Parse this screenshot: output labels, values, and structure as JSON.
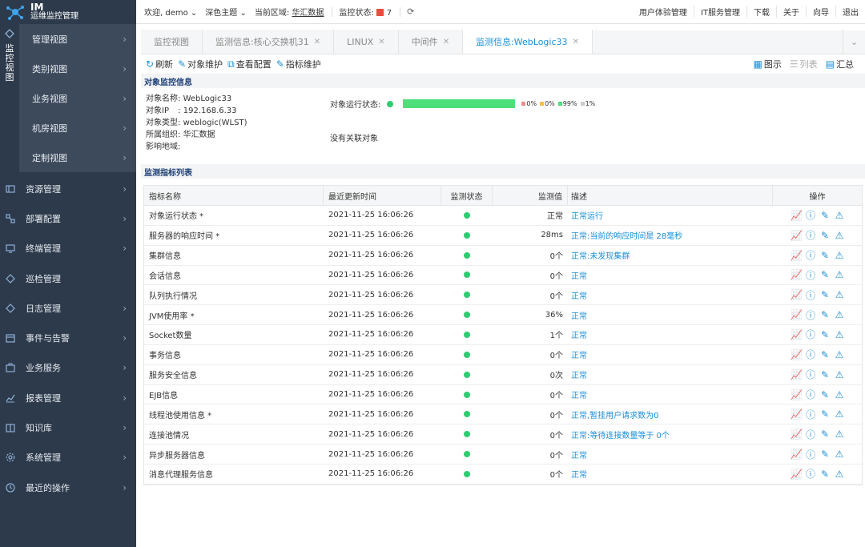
{
  "app": {
    "logo_title": "IM",
    "logo_subtitle": "运维监控管理"
  },
  "topbar": {
    "welcome_label": "欢迎,",
    "user": "demo",
    "theme": "深色主题",
    "region_label": "当前区域:",
    "region_value": "华汇数据",
    "monitor_status_label": "监控状态:",
    "monitor_status_count": "7",
    "right_links": [
      "用户体验管理",
      "IT服务管理",
      "下载",
      "关于",
      "向导",
      "退出"
    ]
  },
  "sidebar": {
    "monitor_view_label": "监控视图",
    "sub_items": [
      "管理视图",
      "类别视图",
      "业务视图",
      "机房视图",
      "定制视图"
    ],
    "items": [
      {
        "label": "资源管理",
        "icon": "resource-icon"
      },
      {
        "label": "部署配置",
        "icon": "deploy-icon"
      },
      {
        "label": "终端管理",
        "icon": "terminal-icon"
      },
      {
        "label": "巡检管理",
        "icon": "inspection-icon"
      },
      {
        "label": "日志管理",
        "icon": "log-icon"
      },
      {
        "label": "事件与告警",
        "icon": "calendar-icon"
      },
      {
        "label": "业务服务",
        "icon": "service-icon"
      },
      {
        "label": "报表管理",
        "icon": "report-icon"
      },
      {
        "label": "知识库",
        "icon": "book-icon"
      },
      {
        "label": "系统管理",
        "icon": "gear-icon"
      },
      {
        "label": "最近的操作",
        "icon": "clock-icon"
      }
    ]
  },
  "tabs": [
    {
      "label": "监控视图",
      "closable": false,
      "active": false
    },
    {
      "label": "监测信息:核心交换机31",
      "closable": true,
      "active": false
    },
    {
      "label": "LINUX",
      "closable": true,
      "active": false
    },
    {
      "label": "中间件",
      "closable": true,
      "active": false
    },
    {
      "label": "监测信息:WebLogic33",
      "closable": true,
      "active": true
    }
  ],
  "toolbar": {
    "refresh": "刷新",
    "object_maintain": "对象维护",
    "view_config": "查看配置",
    "metric_maintain": "指标维护",
    "graph": "图示",
    "list": "列表",
    "summary": "汇总"
  },
  "object_info": {
    "section_title": "对象监控信息",
    "name_label": "对象名称:",
    "name": "WebLogic33",
    "ip_label": "对象IP",
    "ip": "192.168.6.33",
    "type_label": "对象类型:",
    "type": "weblogic(WLST)",
    "org_label": "所属组织:",
    "org": "华汇数据",
    "region_label": "影响地域:",
    "region": "",
    "status_label": "对象运行状态:",
    "legend": [
      {
        "label": "0%",
        "color": "#f08c8c"
      },
      {
        "label": "0%",
        "color": "#f5c04a"
      },
      {
        "label": "99%",
        "color": "#4de07a"
      },
      {
        "label": "1%",
        "color": "#cccccc"
      }
    ],
    "no_related": "没有关联对象"
  },
  "metrics": {
    "section_title": "监测指标列表",
    "headers": [
      "指标名称",
      "最近更新时间",
      "监测状态",
      "监测值",
      "描述",
      "操作"
    ],
    "rows": [
      {
        "name": "对象运行状态 *",
        "time": "2021-11-25 16:06:26",
        "value": "正常",
        "desc": "正常运行"
      },
      {
        "name": "服务器的响应时间 *",
        "time": "2021-11-25 16:06:26",
        "value": "28ms",
        "desc": "正常:当前的响应时间是 28毫秒"
      },
      {
        "name": "集群信息",
        "time": "2021-11-25 16:06:26",
        "value": "0个",
        "desc": "正常:未发现集群"
      },
      {
        "name": "会话信息",
        "time": "2021-11-25 16:06:26",
        "value": "0个",
        "desc": "正常"
      },
      {
        "name": "队列执行情况",
        "time": "2021-11-25 16:06:26",
        "value": "0个",
        "desc": "正常"
      },
      {
        "name": "JVM使用率 *",
        "time": "2021-11-25 16:06:26",
        "value": "36%",
        "desc": "正常"
      },
      {
        "name": "Socket数量",
        "time": "2021-11-25 16:06:26",
        "value": "1个",
        "desc": "正常"
      },
      {
        "name": "事务信息",
        "time": "2021-11-25 16:06:26",
        "value": "0个",
        "desc": "正常"
      },
      {
        "name": "服务安全信息",
        "time": "2021-11-25 16:06:26",
        "value": "0次",
        "desc": "正常"
      },
      {
        "name": "EJB信息",
        "time": "2021-11-25 16:06:26",
        "value": "0个",
        "desc": "正常"
      },
      {
        "name": "线程池使用信息 *",
        "time": "2021-11-25 16:06:26",
        "value": "0个",
        "desc": "正常,暂挂用户请求数为0"
      },
      {
        "name": "连接池情况",
        "time": "2021-11-25 16:06:26",
        "value": "0个",
        "desc": "正常:等待连接数量等于 0个"
      },
      {
        "name": "异步服务器信息",
        "time": "2021-11-25 16:06:26",
        "value": "0个",
        "desc": "正常"
      },
      {
        "name": "消息代理服务信息",
        "time": "2021-11-25 16:06:26",
        "value": "0个",
        "desc": "正常"
      }
    ]
  }
}
